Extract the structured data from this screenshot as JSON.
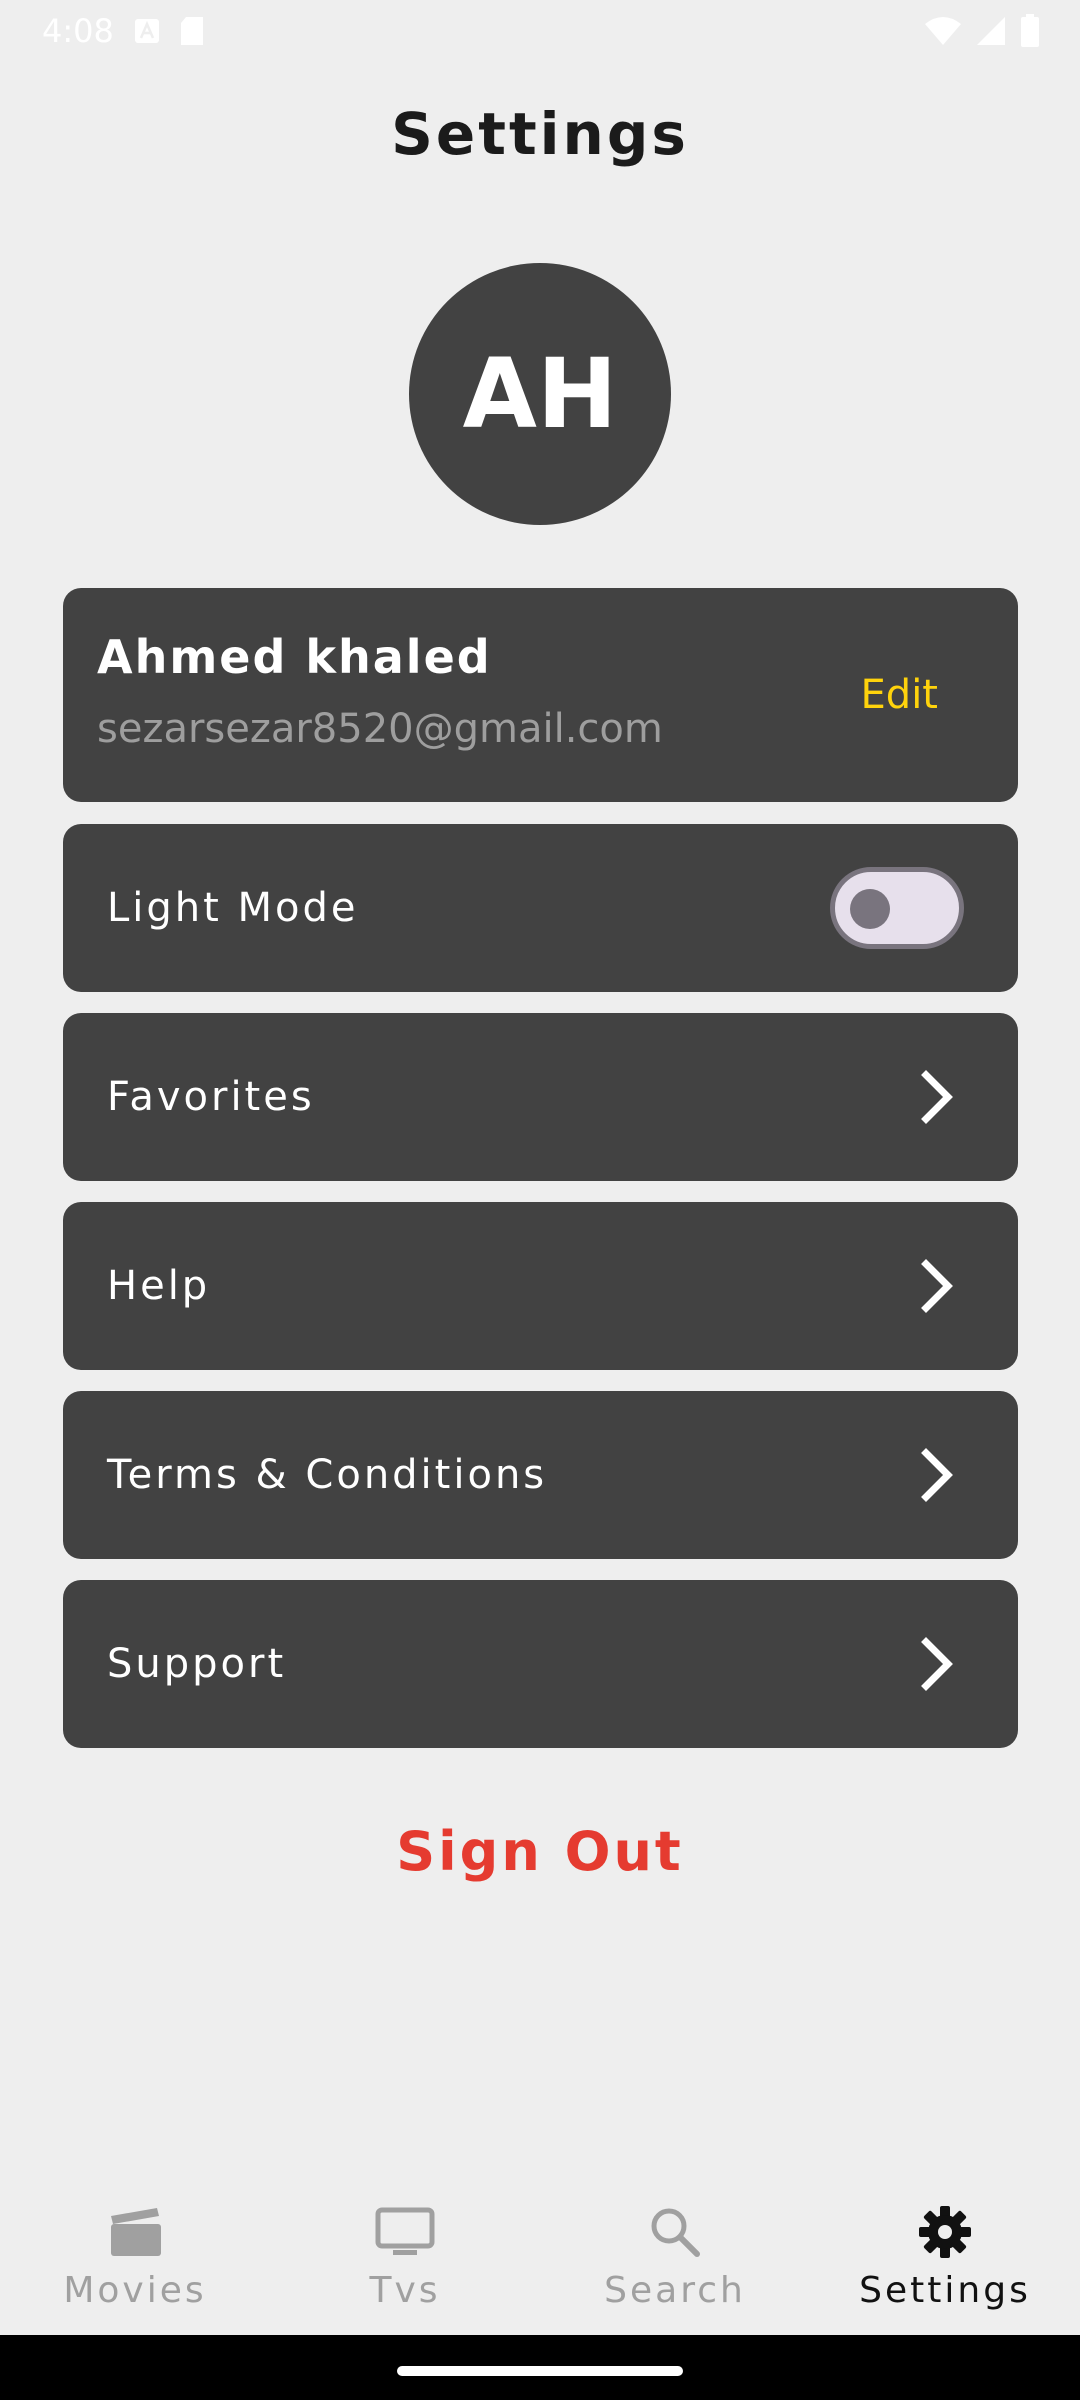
{
  "status_bar": {
    "time": "4:08",
    "left_icons": [
      "a-letter-icon",
      "sd-card-icon"
    ],
    "right_icons": [
      "wifi-icon",
      "signal-icon",
      "battery-icon"
    ]
  },
  "header": {
    "title": "Settings"
  },
  "profile": {
    "initials": "AH",
    "name": "Ahmed khaled",
    "email": "sezarsezar8520@gmail.com",
    "edit_label": "Edit"
  },
  "settings_rows": [
    {
      "label": "Light Mode",
      "control": "toggle",
      "toggle_on": false
    },
    {
      "label": "Favorites",
      "control": "chevron-right-icon"
    },
    {
      "label": "Help",
      "control": "chevron-right-icon"
    },
    {
      "label": "Terms & Conditions",
      "control": "chevron-right-icon"
    },
    {
      "label": "Support",
      "control": "chevron-right-icon"
    }
  ],
  "sign_out_label": "Sign Out",
  "bottom_nav": {
    "items": [
      {
        "label": "Movies",
        "icon": "clapperboard-icon",
        "active": false
      },
      {
        "label": "Tvs",
        "icon": "tv-icon",
        "active": false
      },
      {
        "label": "Search",
        "icon": "search-icon",
        "active": false
      },
      {
        "label": "Settings",
        "icon": "gear-icon",
        "active": true
      }
    ]
  },
  "colors": {
    "background": "#eeeeee",
    "card": "#424242",
    "edit_accent": "#ffd30c",
    "sign_out": "#e53b30",
    "nav_inactive": "#a0a0a0",
    "nav_active": "#111111"
  }
}
